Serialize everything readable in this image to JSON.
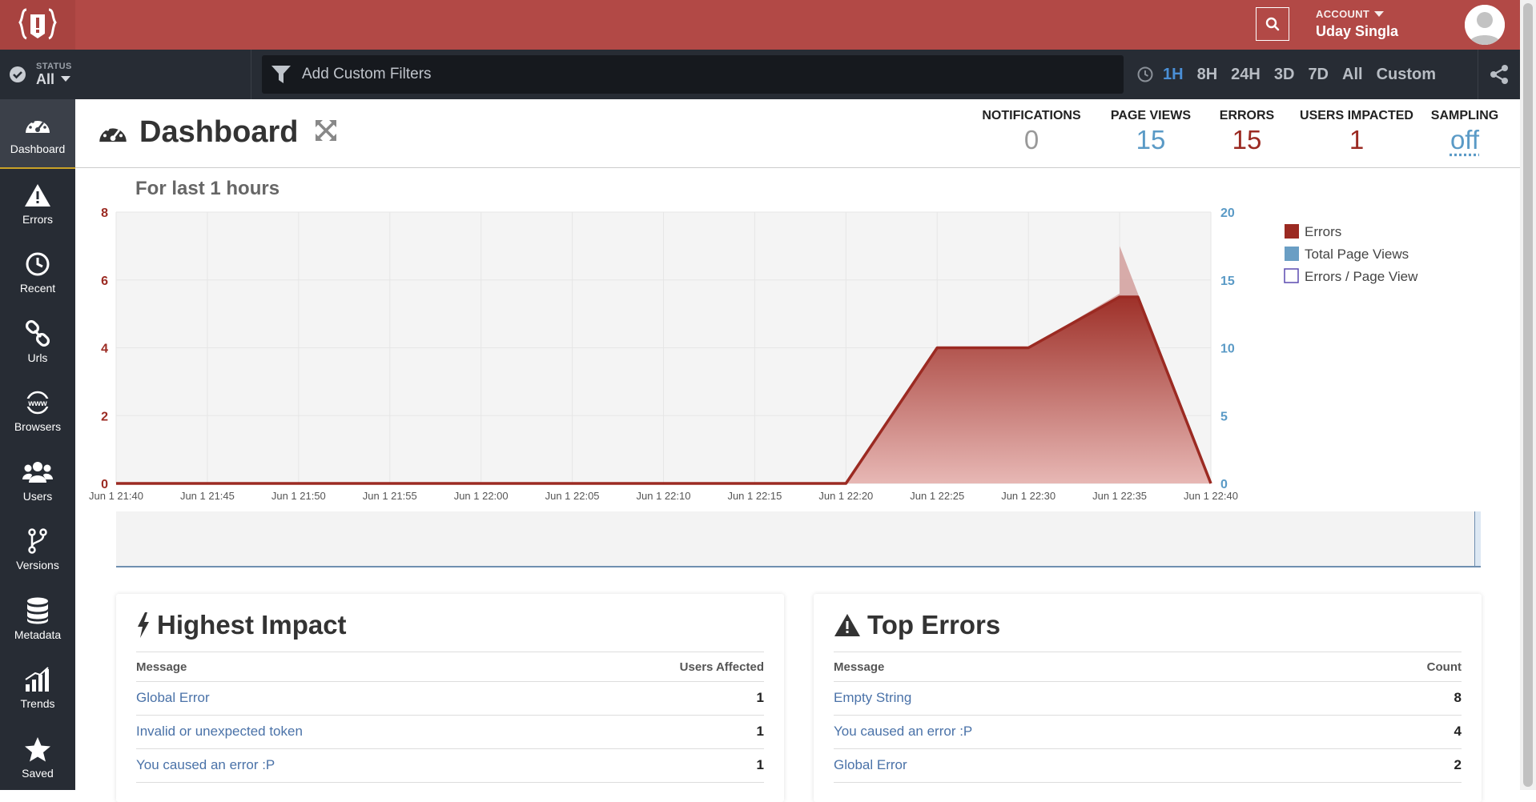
{
  "header": {
    "account_label": "ACCOUNT",
    "account_name": "Uday Singla"
  },
  "filterbar": {
    "status_label": "STATUS",
    "status_value": "All",
    "filter_placeholder": "Add Custom Filters",
    "time_ranges": [
      "1H",
      "8H",
      "24H",
      "3D",
      "7D",
      "All",
      "Custom"
    ],
    "active_range": "1H"
  },
  "sidebar": {
    "items": [
      {
        "label": "Dashboard",
        "icon": "gauge-icon"
      },
      {
        "label": "Errors",
        "icon": "warning-icon"
      },
      {
        "label": "Recent",
        "icon": "clock-icon"
      },
      {
        "label": "Urls",
        "icon": "link-icon"
      },
      {
        "label": "Browsers",
        "icon": "www-icon"
      },
      {
        "label": "Users",
        "icon": "users-icon"
      },
      {
        "label": "Versions",
        "icon": "branch-icon"
      },
      {
        "label": "Metadata",
        "icon": "database-icon"
      },
      {
        "label": "Trends",
        "icon": "bar-chart-icon"
      },
      {
        "label": "Saved",
        "icon": "star-icon"
      }
    ]
  },
  "dashboard": {
    "title": "Dashboard",
    "stats": [
      {
        "label": "NOTIFICATIONS",
        "value": "0",
        "color": "#999999"
      },
      {
        "label": "PAGE VIEWS",
        "value": "15",
        "color": "#5a9ac6"
      },
      {
        "label": "ERRORS",
        "value": "15",
        "color": "#9b2a22"
      },
      {
        "label": "USERS IMPACTED",
        "value": "1",
        "color": "#9b2a22"
      },
      {
        "label": "SAMPLING",
        "value": "off",
        "color": "#5a9ac6"
      }
    ],
    "range_title": "For last 1 hours"
  },
  "chart_data": {
    "type": "area",
    "title": "For last 1 hours",
    "x": [
      "Jun 1 21:40",
      "Jun 1 21:45",
      "Jun 1 21:50",
      "Jun 1 21:55",
      "Jun 1 22:00",
      "Jun 1 22:05",
      "Jun 1 22:10",
      "Jun 1 22:15",
      "Jun 1 22:20",
      "Jun 1 22:25",
      "Jun 1 22:30",
      "Jun 1 22:35",
      "Jun 1 22:40"
    ],
    "series": [
      {
        "name": "Errors",
        "axis": "left",
        "color": "#9b2a22",
        "values": [
          0,
          0,
          0,
          0,
          0,
          0,
          0,
          0,
          0,
          4,
          4,
          5.5,
          0
        ],
        "extra_points": [
          {
            "x": "Jun 1 22:36",
            "y": 5.5
          }
        ]
      },
      {
        "name": "Total Page Views",
        "axis": "right",
        "color": "#6a9ec4",
        "values": [
          0,
          0,
          0,
          0,
          0,
          0,
          0,
          0,
          0,
          10,
          10,
          14,
          0
        ],
        "extra_points": [
          {
            "x": "Jun 1 22:35",
            "y": 17.5
          }
        ]
      },
      {
        "name": "Errors / Page View",
        "axis": "right",
        "color": "#5b4bb0",
        "values": []
      }
    ],
    "y_left": {
      "range": [
        0,
        8
      ],
      "ticks": [
        0,
        2,
        4,
        6,
        8
      ],
      "color": "#9b2a22"
    },
    "y_right": {
      "range": [
        0,
        20
      ],
      "ticks": [
        0,
        5,
        10,
        15,
        20
      ],
      "color": "#5a9ac6"
    },
    "grid": true,
    "legend_position": "top-right"
  },
  "highest_impact": {
    "title": "Highest Impact",
    "col_message": "Message",
    "col_value": "Users Affected",
    "rows": [
      {
        "message": "Global Error",
        "value": "1"
      },
      {
        "message": "Invalid or unexpected token",
        "value": "1"
      },
      {
        "message": "You caused an error :P",
        "value": "1"
      }
    ]
  },
  "top_errors": {
    "title": "Top Errors",
    "col_message": "Message",
    "col_value": "Count",
    "rows": [
      {
        "message": "Empty String",
        "value": "8"
      },
      {
        "message": "You caused an error :P",
        "value": "4"
      },
      {
        "message": "Global Error",
        "value": "2"
      }
    ]
  }
}
